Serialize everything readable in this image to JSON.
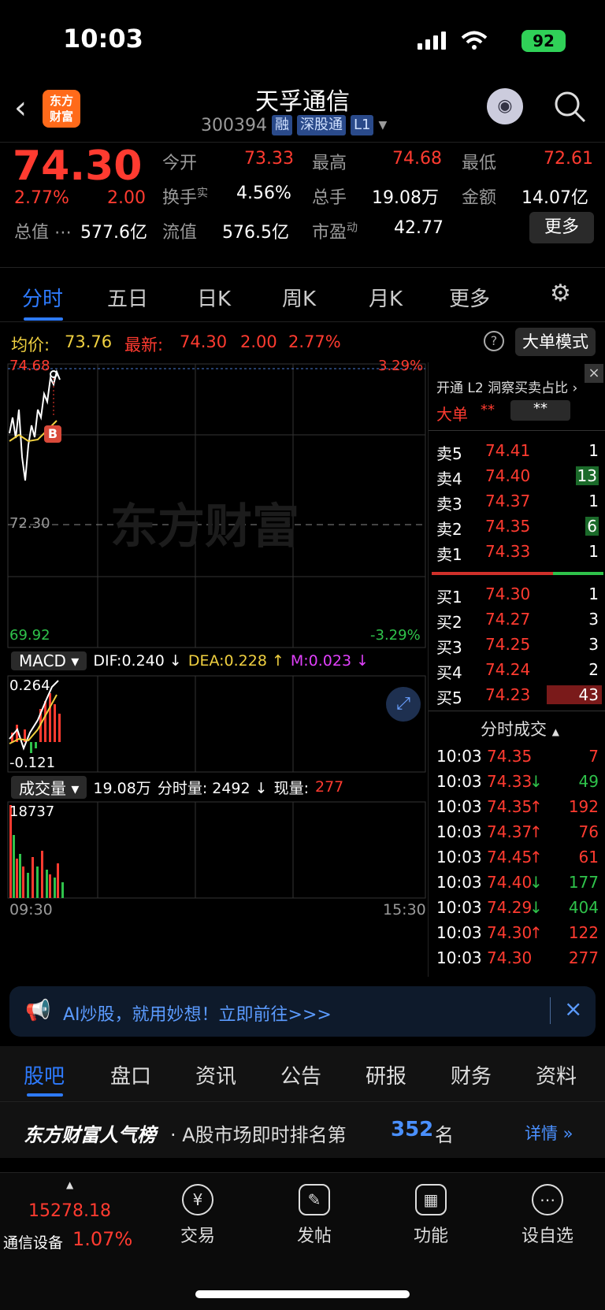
{
  "status": {
    "time": "10:03",
    "battery": "92"
  },
  "header": {
    "logo": "东方\n财富",
    "stock_name": "天孚通信",
    "code": "300394",
    "tags": [
      "融",
      "深股通",
      "L1"
    ]
  },
  "quote": {
    "price": "74.30",
    "pct": "2.77%",
    "change": "2.00",
    "open_label": "今开",
    "open": "73.33",
    "high_label": "最高",
    "high": "74.68",
    "low_label": "最低",
    "low": "72.61",
    "turnover_label": "换手",
    "turnover_sup": "实",
    "turnover": "4.56%",
    "volume_label": "总手",
    "volume": "19.08万",
    "amount_label": "金额",
    "amount": "14.07亿",
    "mktcap_label": "总值",
    "mktcap": "577.6亿",
    "float_label": "流值",
    "float": "576.5亿",
    "pe_label": "市盈",
    "pe_sup": "动",
    "pe": "42.77",
    "more_button": "更多"
  },
  "tabs": [
    "分时",
    "五日",
    "日K",
    "周K",
    "月K",
    "更多"
  ],
  "priceline": {
    "avg_label": "均价:",
    "avg": "73.76",
    "last_label": "最新:",
    "last": "74.30",
    "chg": "2.00",
    "pct": "2.77%",
    "mode_button": "大单模式"
  },
  "chart": {
    "top_price": "74.68",
    "top_pct": "3.29%",
    "mid_price": "72.30",
    "bottom_price": "69.92",
    "bottom_pct": "-3.29%",
    "watermark": "东方财富",
    "b_marker": "B",
    "macd_label": "MACD",
    "dif": "DIF:0.240 ↓",
    "dea": "DEA:0.228 ↑",
    "m": "M:0.023 ↓",
    "macd_top": "0.264",
    "macd_bottom": "-0.121",
    "vol_label": "成交量",
    "vol_total": "19.08万",
    "vol_min": "分时量: 2492 ↓",
    "vol_now_label": "现量:",
    "vol_now": "277",
    "vol_max": "18737",
    "time_start": "09:30",
    "time_end": "15:30"
  },
  "book": {
    "l2_promo": "开通 L2 洞察买卖占比 ›",
    "big_label": "大单",
    "big_val1": "**",
    "big_val2": "**",
    "asks": [
      {
        "label": "卖5",
        "price": "74.41",
        "vol": "1"
      },
      {
        "label": "卖4",
        "price": "74.40",
        "vol": "13"
      },
      {
        "label": "卖3",
        "price": "74.37",
        "vol": "1"
      },
      {
        "label": "卖2",
        "price": "74.35",
        "vol": "6"
      },
      {
        "label": "卖1",
        "price": "74.33",
        "vol": "1"
      }
    ],
    "bids": [
      {
        "label": "买1",
        "price": "74.30",
        "vol": "1"
      },
      {
        "label": "买2",
        "price": "74.27",
        "vol": "3"
      },
      {
        "label": "买3",
        "price": "74.25",
        "vol": "3"
      },
      {
        "label": "买4",
        "price": "74.24",
        "vol": "2"
      },
      {
        "label": "买5",
        "price": "74.23",
        "vol": "43"
      }
    ],
    "ticks_title": "分时成交",
    "ticks": [
      {
        "time": "10:03",
        "price": "74.35",
        "arrow": "",
        "vol": "7"
      },
      {
        "time": "10:03",
        "price": "74.33",
        "arrow": "↓",
        "vol": "49"
      },
      {
        "time": "10:03",
        "price": "74.35",
        "arrow": "↑",
        "vol": "192"
      },
      {
        "time": "10:03",
        "price": "74.37",
        "arrow": "↑",
        "vol": "76"
      },
      {
        "time": "10:03",
        "price": "74.45",
        "arrow": "↑",
        "vol": "61"
      },
      {
        "time": "10:03",
        "price": "74.40",
        "arrow": "↓",
        "vol": "177"
      },
      {
        "time": "10:03",
        "price": "74.29",
        "arrow": "↓",
        "vol": "404"
      },
      {
        "time": "10:03",
        "price": "74.30",
        "arrow": "↑",
        "vol": "122"
      },
      {
        "time": "10:03",
        "price": "74.30",
        "arrow": "",
        "vol": "277"
      }
    ]
  },
  "ai_banner": "AI炒股，就用妙想！立即前往>>>",
  "section_tabs": [
    "股吧",
    "盘口",
    "资讯",
    "公告",
    "研报",
    "财务",
    "资料"
  ],
  "rank": {
    "brand": "东方财富人气榜",
    "text": "· A股市场即时排名第",
    "num": "352",
    "suffix": "名",
    "detail": "详情"
  },
  "bottom": {
    "index_value": "15278.18",
    "index_name": "通信设备",
    "index_pct": "1.07%",
    "nav": [
      {
        "label": "交易",
        "icon": "¥"
      },
      {
        "label": "发帖",
        "icon": "✎"
      },
      {
        "label": "功能",
        "icon": "▦"
      },
      {
        "label": "设自选",
        "icon": "⋯"
      }
    ]
  },
  "colors": {
    "up": "#ff3b30",
    "down": "#2fc34b",
    "accent": "#2e7bff",
    "avg": "#f0d040"
  }
}
